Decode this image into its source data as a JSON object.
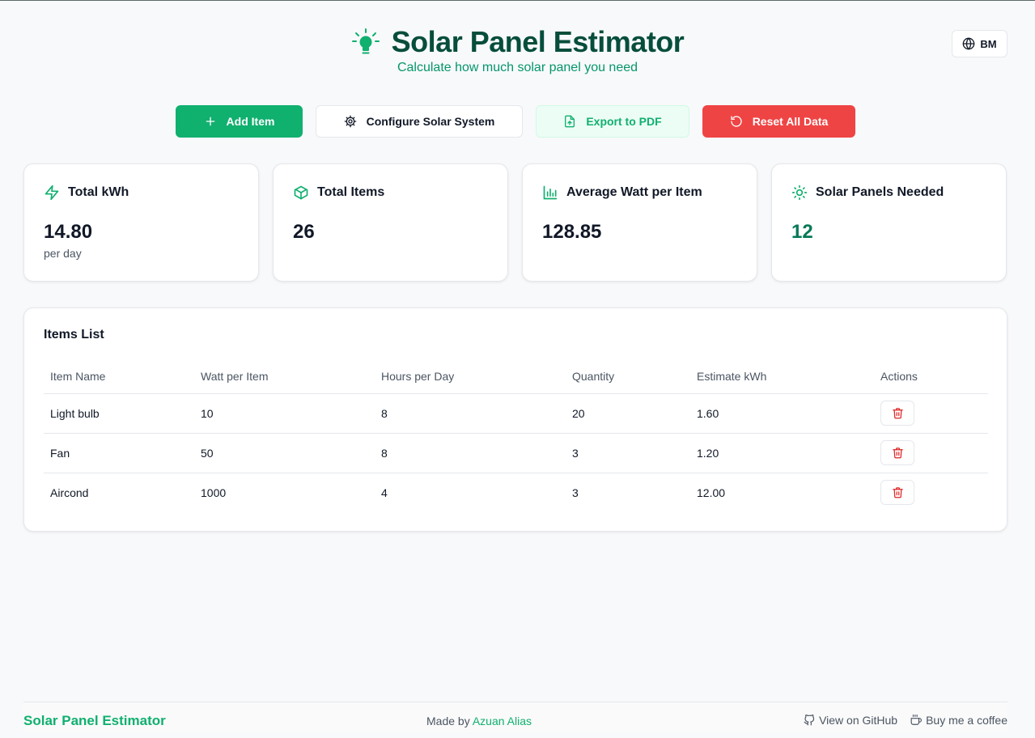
{
  "app": {
    "title": "Solar Panel Estimator",
    "subtitle": "Calculate how much solar panel you need",
    "language": "BM"
  },
  "toolbar": {
    "add_label": "Add Item",
    "configure_label": "Configure Solar System",
    "export_label": "Export to PDF",
    "reset_label": "Reset All Data"
  },
  "stats": [
    {
      "label": "Total kWh",
      "value": "14.80",
      "sub": "per day",
      "icon": "zap-icon"
    },
    {
      "label": "Total Items",
      "value": "26",
      "icon": "package-icon"
    },
    {
      "label": "Average Watt per Item",
      "value": "128.85",
      "icon": "bar-chart-icon"
    },
    {
      "label": "Solar Panels Needed",
      "value": "12",
      "icon": "sun-icon"
    }
  ],
  "items_list": {
    "title": "Items List",
    "columns": [
      "Item Name",
      "Watt per Item",
      "Hours per Day",
      "Quantity",
      "Estimate kWh",
      "Actions"
    ],
    "rows": [
      {
        "name": "Light bulb",
        "watt": "10",
        "hours": "8",
        "qty": "20",
        "kwh": "1.60"
      },
      {
        "name": "Fan",
        "watt": "50",
        "hours": "8",
        "qty": "3",
        "kwh": "1.20"
      },
      {
        "name": "Aircond",
        "watt": "1000",
        "hours": "4",
        "qty": "3",
        "kwh": "12.00"
      }
    ]
  },
  "footer": {
    "brand": "Solar Panel Estimator",
    "made_by_prefix": "Made by",
    "author": "Azuan Alias",
    "github": "View on GitHub",
    "coffee": "Buy me a coffee"
  },
  "colors": {
    "primary": "#10b06f",
    "title": "#064e3b",
    "danger": "#ef4444",
    "background": "#f8f9fb"
  }
}
